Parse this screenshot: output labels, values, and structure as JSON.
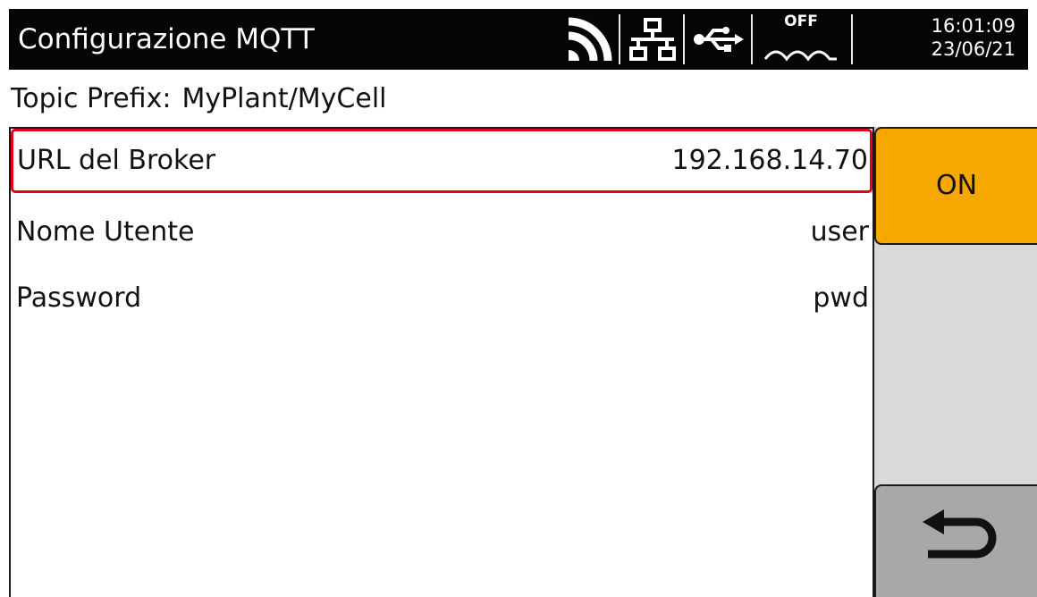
{
  "header": {
    "title": "Configurazione MQTT",
    "status": {
      "wifi_icon": "wifi-icon",
      "network_icon": "network-icon",
      "usb_icon": "usb-icon",
      "service_label": "OFF",
      "service_icon": "wave-icon"
    },
    "clock": {
      "time": "16:01:09",
      "date": "23/06/21"
    }
  },
  "topic": {
    "label": "Topic Prefix:",
    "value": "MyPlant/MyCell"
  },
  "settings": [
    {
      "label": "URL del Broker",
      "value": "192.168.14.70"
    },
    {
      "label": "Nome Utente",
      "value": "user"
    },
    {
      "label": "Password",
      "value": "pwd"
    }
  ],
  "softkeys": {
    "on_label": "ON",
    "back_icon": "back-arrow-icon"
  },
  "colors": {
    "header_bg": "#050505",
    "accent": "#f7a800",
    "selection": "#e2001a",
    "softkey_panel": "#d9d9d9",
    "back_key": "#a8a8a8"
  }
}
